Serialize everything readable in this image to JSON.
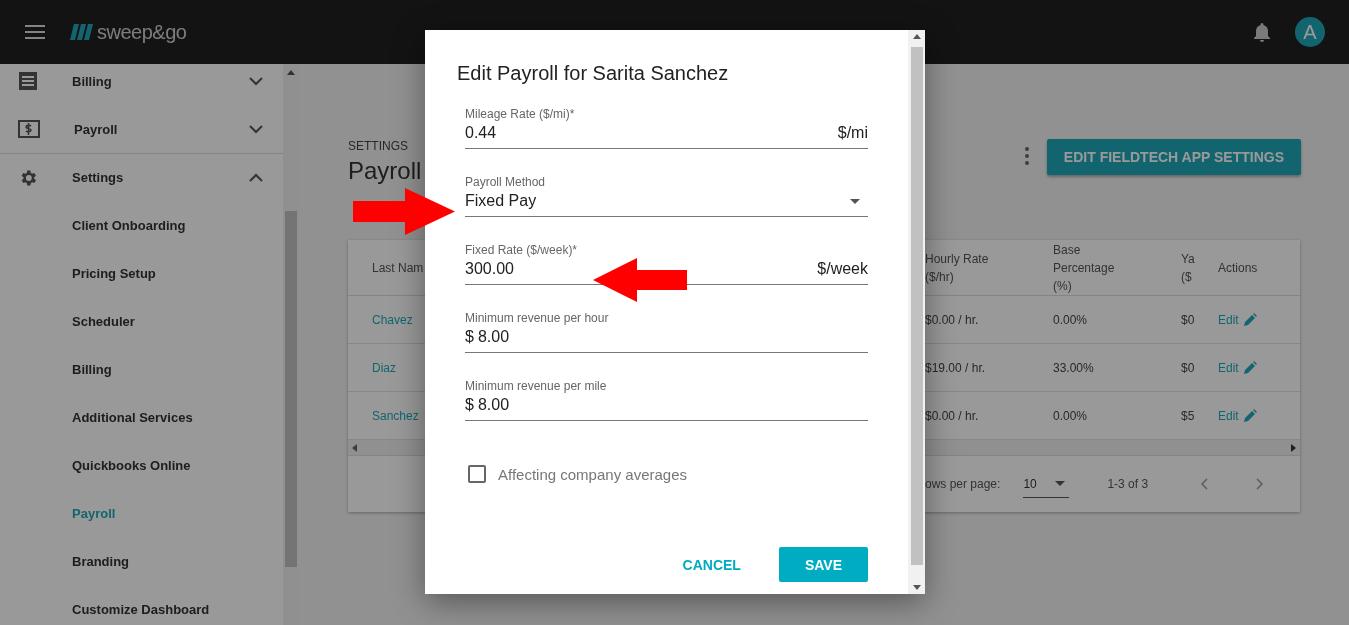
{
  "header": {
    "logo": "sweep&go",
    "avatar": "A"
  },
  "sidebar": {
    "items": [
      {
        "label": "Billing",
        "expanded": false
      },
      {
        "label": "Payroll",
        "expanded": false
      },
      {
        "label": "Settings",
        "expanded": true,
        "children": [
          {
            "label": "Client Onboarding",
            "selected": false
          },
          {
            "label": "Pricing Setup",
            "selected": false
          },
          {
            "label": "Scheduler",
            "selected": false
          },
          {
            "label": "Billing",
            "selected": false
          },
          {
            "label": "Additional Services",
            "selected": false
          },
          {
            "label": "Quickbooks Online",
            "selected": false
          },
          {
            "label": "Payroll",
            "selected": true
          },
          {
            "label": "Branding",
            "selected": false
          },
          {
            "label": "Customize Dashboard",
            "selected": false
          }
        ]
      }
    ]
  },
  "page": {
    "breadcrumb": "SETTINGS",
    "title": "Payroll",
    "action_button": "EDIT FIELDTECH APP SETTINGS"
  },
  "table": {
    "columns": [
      [
        "Last Nam"
      ],
      [
        "Hourly Rate",
        "($/hr)"
      ],
      [
        "Base",
        "Percentage",
        "(%)"
      ],
      [
        "Ya",
        "($"
      ],
      [
        "Actions"
      ]
    ],
    "rows": [
      {
        "last_name": "Chavez",
        "hourly_rate": "$0.00 / hr.",
        "base_percentage": "0.00%",
        "column_4": "$0",
        "action": "Edit"
      },
      {
        "last_name": "Diaz",
        "hourly_rate": "$19.00 / hr.",
        "base_percentage": "33.00%",
        "column_4": "$0",
        "action": "Edit"
      },
      {
        "last_name": "Sanchez",
        "hourly_rate": "$0.00 / hr.",
        "base_percentage": "0.00%",
        "column_4": "$5",
        "action": "Edit"
      }
    ],
    "pagination": {
      "rows_per_page_label": "ows per page:",
      "rows_per_page": "10",
      "range": "1-3 of 3"
    }
  },
  "dialog": {
    "title": "Edit Payroll for Sarita Sanchez",
    "fields": [
      {
        "kind": "text",
        "label": "Mileage Rate ($/mi)*",
        "value": "0.44",
        "suffix": "$/mi"
      },
      {
        "kind": "select",
        "label": "Payroll Method",
        "value": "Fixed Pay"
      },
      {
        "kind": "text",
        "label": "Fixed Rate ($/week)*",
        "value": "300.00",
        "suffix": "$/week"
      },
      {
        "kind": "text",
        "label": "Minimum revenue per hour",
        "prefix": "$",
        "value": "8.00"
      },
      {
        "kind": "text",
        "label": "Minimum revenue per mile",
        "prefix": "$",
        "value": "8.00"
      }
    ],
    "checkbox": {
      "label": "Affecting company averages",
      "checked": false
    },
    "buttons": [
      {
        "label": "CANCEL",
        "kind": "text"
      },
      {
        "label": "SAVE",
        "kind": "primary"
      }
    ]
  }
}
